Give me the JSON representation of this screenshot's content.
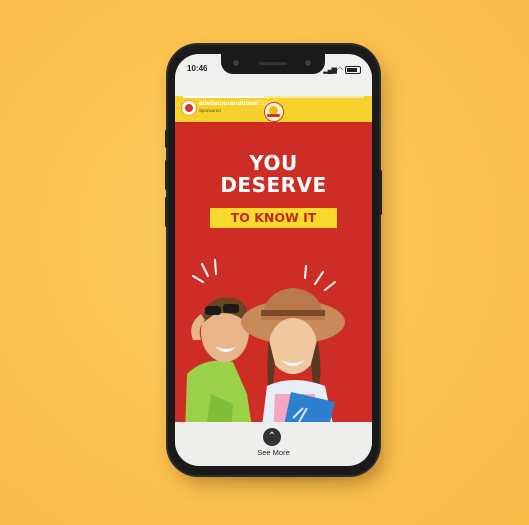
{
  "status_bar": {
    "time": "10:46",
    "signal_icon": "signal-wifi-icon",
    "battery_icon": "battery-icon"
  },
  "story": {
    "username": "adellatourandtravel",
    "time_ago": "21m",
    "subtitle": "Sponsored",
    "progress": 0.45,
    "brand_logo_icon": "sun-logo-icon"
  },
  "content": {
    "headline_line1": "YOU",
    "headline_line2": "DESERVE",
    "tag_text": "TO KNOW IT"
  },
  "footer": {
    "see_more_icon": "chevron-up-icon",
    "see_more_label": "See More"
  },
  "colors": {
    "background": "#fbc14f",
    "story_red": "#cd2d24",
    "accent_yellow": "#f9d92b"
  }
}
